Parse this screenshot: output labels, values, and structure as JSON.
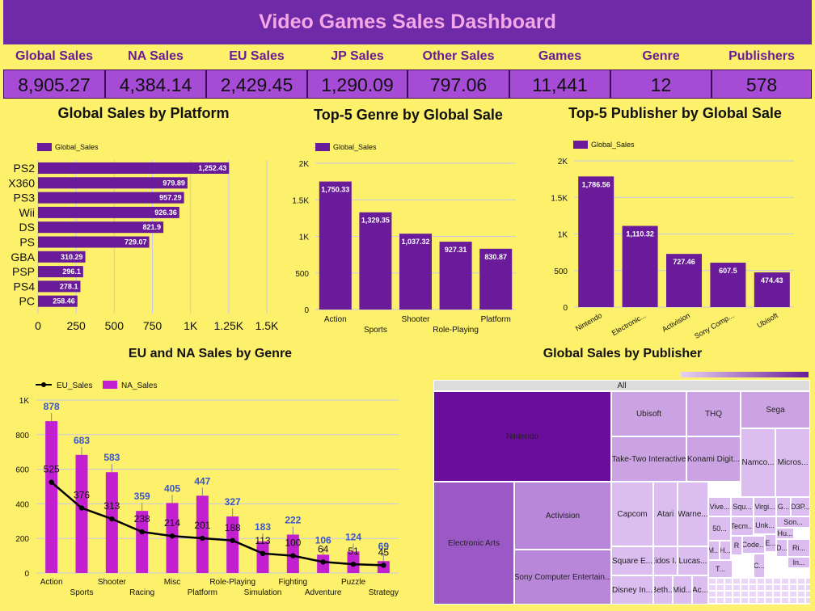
{
  "header": {
    "title": "Video Games Sales Dashboard"
  },
  "kpis": [
    {
      "label": "Global Sales",
      "value": "8,905.27"
    },
    {
      "label": "NA Sales",
      "value": "4,384.14"
    },
    {
      "label": "EU Sales",
      "value": "2,429.45"
    },
    {
      "label": "JP Sales",
      "value": "1,290.09"
    },
    {
      "label": "Other Sales",
      "value": "797.06"
    },
    {
      "label": "Games",
      "value": "11,441"
    },
    {
      "label": "Genre",
      "value": "12"
    },
    {
      "label": "Publishers",
      "value": "578"
    }
  ],
  "colors": {
    "bar": "#6a1b9a",
    "na_bar": "#c21fd1",
    "eu_line": "#000000",
    "na_label": "#3a56c9",
    "header": "#6f2aa8"
  },
  "chart_data": [
    {
      "type": "bar",
      "orientation": "horizontal",
      "title": "Global Sales by Platform",
      "legend": "Global_Sales",
      "categories": [
        "PS2",
        "X360",
        "PS3",
        "Wii",
        "DS",
        "PS",
        "GBA",
        "PSP",
        "PS4",
        "PC"
      ],
      "values": [
        1252.43,
        979.89,
        957.29,
        926.36,
        821.9,
        729.07,
        310.29,
        296.1,
        278.1,
        258.46
      ],
      "value_labels": [
        "1,252.43",
        "979.89",
        "957.29",
        "926.36",
        "821.9",
        "729.07",
        "310.29",
        "296.1",
        "278.1",
        "258.46"
      ],
      "xticks": [
        "0",
        "250",
        "500",
        "750",
        "1K",
        "1.25K",
        "1.5K"
      ],
      "xlim": [
        0,
        1500
      ]
    },
    {
      "type": "bar",
      "title": "Top-5 Genre by Global Sale",
      "legend": "Global_Sales",
      "categories": [
        "Action",
        "Sports",
        "Shooter",
        "Role-Playing",
        "Platform"
      ],
      "values": [
        1750.33,
        1329.35,
        1037.32,
        927.31,
        830.87
      ],
      "value_labels": [
        "1,750.33",
        "1,329.35",
        "1,037.32",
        "927.31",
        "830.87"
      ],
      "yticks": [
        "0",
        "500",
        "1K",
        "1.5K",
        "2K"
      ],
      "ylim": [
        0,
        2000
      ]
    },
    {
      "type": "bar",
      "title": "Top-5 Publisher by Global Sale",
      "legend": "Global_Sales",
      "categories": [
        "Nintendo",
        "Electronic...",
        "Activision",
        "Sony Comp...",
        "Ubisoft"
      ],
      "values": [
        1786.56,
        1110.32,
        727.46,
        607.5,
        474.43
      ],
      "value_labels": [
        "1,786.56",
        "1,110.32",
        "727.46",
        "607.5",
        "474.43"
      ],
      "yticks": [
        "0",
        "500",
        "1K",
        "1.5K",
        "2K"
      ],
      "ylim": [
        0,
        2000
      ]
    },
    {
      "type": "bar",
      "title": "EU and NA Sales by Genre",
      "categories": [
        "Action",
        "Sports",
        "Shooter",
        "Racing",
        "Misc",
        "Platform",
        "Role-Playing",
        "Simulation",
        "Fighting",
        "Adventure",
        "Puzzle",
        "Strategy"
      ],
      "series": [
        {
          "name": "NA_Sales",
          "type": "bar",
          "values": [
            878,
            683,
            583,
            359,
            405,
            447,
            327,
            183,
            222,
            106,
            124,
            69
          ]
        },
        {
          "name": "EU_Sales",
          "type": "line",
          "values": [
            525,
            376,
            313,
            238,
            214,
            201,
            188,
            113,
            100,
            64,
            51,
            45
          ]
        }
      ],
      "yticks": [
        "0",
        "200",
        "400",
        "600",
        "800",
        "1K"
      ],
      "ylim": [
        0,
        1000
      ]
    },
    {
      "type": "treemap",
      "title": "Global Sales by Publisher",
      "root_label": "All",
      "labels": [
        "Nintendo",
        "Electronic Arts",
        "Activision",
        "Sony Computer Entertain...",
        "Ubisoft",
        "THQ",
        "Sega",
        "Take-Two Interactive",
        "Konami Digit...",
        "Namco...",
        "Micros...",
        "Capcom",
        "Atari",
        "Warne...",
        "Square E...",
        "Eidos I...",
        "Lucas...",
        "Disney In...",
        "Beth...",
        "Mid...",
        "Ac...",
        "Vive...",
        "Squ...",
        "Virgi...",
        "G...",
        "D3P...",
        "Son...",
        "50...",
        "Tecm...",
        "Unk...",
        "Hu...",
        "M...",
        "H...",
        "R",
        "Code...",
        "E...",
        "D...",
        "Ri...",
        "In...",
        "T...",
        "C..."
      ]
    }
  ]
}
